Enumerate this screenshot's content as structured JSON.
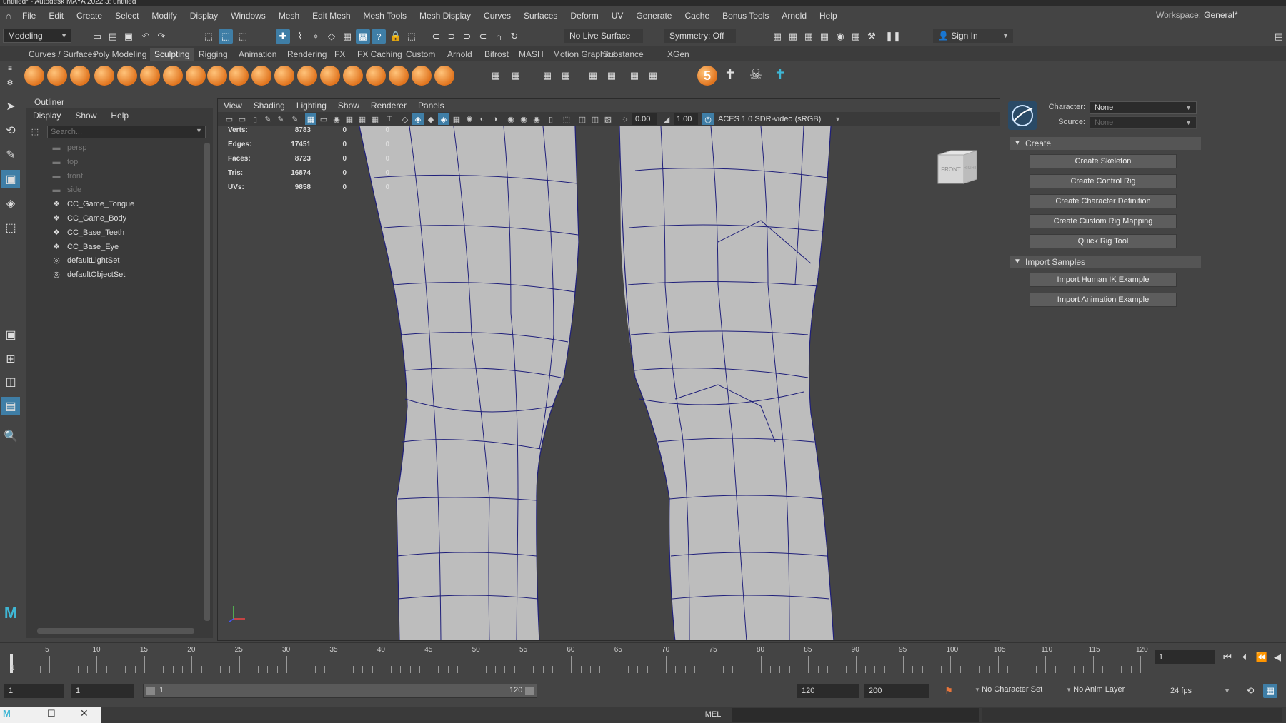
{
  "window": {
    "title": "untitled* - Autodesk MAYA 2022.3: untitled"
  },
  "menubar": {
    "items": [
      "File",
      "Edit",
      "Create",
      "Select",
      "Modify",
      "Display",
      "Windows",
      "Mesh",
      "Edit Mesh",
      "Mesh Tools",
      "Mesh Display",
      "Curves",
      "Surfaces",
      "Deform",
      "UV",
      "Generate",
      "Cache",
      "Bonus Tools",
      "Arnold",
      "Help"
    ],
    "workspace_label": "Workspace:",
    "workspace_value": "General*"
  },
  "statusline": {
    "mode": "Modeling",
    "live_surface": "No Live Surface",
    "symmetry": "Symmetry: Off",
    "sign_in": "Sign In"
  },
  "shelf": {
    "tabs": [
      "Curves / Surfaces",
      "Poly Modeling",
      "Sculpting",
      "Rigging",
      "Animation",
      "Rendering",
      "FX",
      "FX Caching",
      "Custom",
      "Arnold",
      "Bifrost",
      "MASH",
      "Motion Graphics",
      "Substance",
      "XGen"
    ],
    "active_tab": "Sculpting",
    "badge_number": "5"
  },
  "outliner": {
    "title": "Outliner",
    "menu": [
      "Display",
      "Show",
      "Help"
    ],
    "search_placeholder": "Search...",
    "items": [
      {
        "label": "persp",
        "dim": true,
        "icon": "camera-icon"
      },
      {
        "label": "top",
        "dim": true,
        "icon": "camera-icon"
      },
      {
        "label": "front",
        "dim": true,
        "icon": "camera-icon"
      },
      {
        "label": "side",
        "dim": true,
        "icon": "camera-icon"
      },
      {
        "label": "CC_Game_Tongue",
        "dim": false,
        "icon": "mesh-icon"
      },
      {
        "label": "CC_Game_Body",
        "dim": false,
        "icon": "mesh-icon"
      },
      {
        "label": "CC_Base_Teeth",
        "dim": false,
        "icon": "mesh-icon"
      },
      {
        "label": "CC_Base_Eye",
        "dim": false,
        "icon": "mesh-icon"
      },
      {
        "label": "defaultLightSet",
        "dim": false,
        "icon": "set-icon"
      },
      {
        "label": "defaultObjectSet",
        "dim": false,
        "icon": "set-icon"
      }
    ]
  },
  "viewport": {
    "menu": [
      "View",
      "Shading",
      "Lighting",
      "Show",
      "Renderer",
      "Panels"
    ],
    "exposure": "0.00",
    "gamma": "1.00",
    "color_space": "ACES 1.0 SDR-video (sRGB)",
    "hud": [
      {
        "label": "Verts:",
        "value": "8783",
        "a": "0",
        "b": "0"
      },
      {
        "label": "Edges:",
        "value": "17451",
        "a": "0",
        "b": "0"
      },
      {
        "label": "Faces:",
        "value": "8723",
        "a": "0",
        "b": "0"
      },
      {
        "label": "Tris:",
        "value": "16874",
        "a": "0",
        "b": "0"
      },
      {
        "label": "UVs:",
        "value": "9858",
        "a": "0",
        "b": "0"
      }
    ],
    "viewcube": {
      "front": "FRONT",
      "right": "RIGHT"
    }
  },
  "hik": {
    "character_label": "Character:",
    "character_value": "None",
    "source_label": "Source:",
    "source_value": "None",
    "create_section": "Create",
    "create_buttons": [
      "Create Skeleton",
      "Create Control Rig",
      "Create Character Definition",
      "Create Custom Rig Mapping",
      "Quick Rig Tool"
    ],
    "import_section": "Import Samples",
    "import_buttons": [
      "Import Human IK Example",
      "Import Animation Example"
    ]
  },
  "timeline": {
    "ticks": [
      5,
      10,
      15,
      20,
      25,
      30,
      35,
      40,
      45,
      50,
      55,
      60,
      65,
      70,
      75,
      80,
      85,
      90,
      95,
      100,
      105,
      110,
      115,
      120
    ],
    "start": 1,
    "end": 120,
    "current_frame": "1",
    "current_marker": "1"
  },
  "range": {
    "start": "1",
    "playback_start": "1",
    "slider_start": "1",
    "slider_end": "120",
    "playback_end": "120",
    "end": "200",
    "character_set": "No Character Set",
    "anim_layer": "No Anim Layer",
    "fps": "24 fps"
  },
  "cmdline": {
    "language": "MEL"
  }
}
